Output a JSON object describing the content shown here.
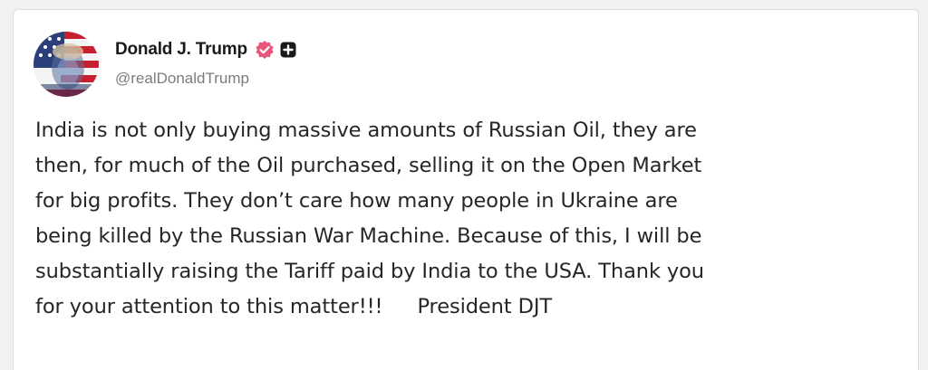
{
  "post": {
    "author": {
      "display_name": "Donald J. Trump",
      "handle": "@realDonaldTrump",
      "avatar_icon": "flag-portrait-avatar",
      "verified_icon": "verified-badge-icon",
      "verified_color": "#e8547a",
      "extra_badge_icon": "plus-badge-icon"
    },
    "text_lines": [
      "India is not only buying massive amounts of Russian Oil, they are",
      "then, for much of the Oil purchased, selling it on the Open Market",
      "for big profits. They don’t care how many people in Ukraine are",
      "being killed by the Russian War Machine. Because of this, I will be",
      "substantially raising the Tariff paid by India to the USA. Thank you",
      "for your attention to this matter!!!"
    ],
    "signature": "President DJT"
  }
}
